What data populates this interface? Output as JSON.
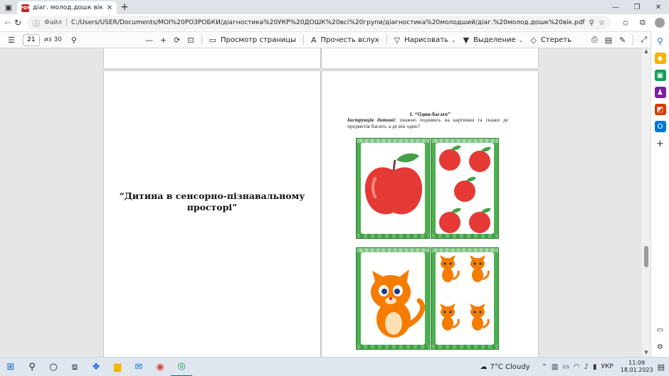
{
  "browser": {
    "tab_title": "діаг. молод.дошк вік.pdf",
    "tab_icon": "PDF",
    "url_label": "Файл",
    "url": "C:/Users/USER/Documents/МОЇ%20РОЗРОБКИ/діагностика%20УКР%20ДОШК%20всі%20групи/діагностика%20молодший/діаг.%20молод.дошк%20вік.pdf"
  },
  "pdf_toolbar": {
    "page_current": "21",
    "page_total_label": "из 30",
    "view_label": "Просмотр страницы",
    "read_aloud_label": "Прочесть вслух",
    "draw_label": "Нарисовать",
    "highlight_label": "Выделение",
    "erase_label": "Стереть"
  },
  "document": {
    "left_page_title": "“Дитина в сенсорно-пізнавальному просторі”",
    "task_heading": "1.  “Один-багато”",
    "task_instruction_label": "Інструкція дитині:",
    "task_instruction_text": " уважно подивись на картинки та скажи де предметів багато, а де він один?"
  },
  "taskbar": {
    "weather": "7°C  Cloudy",
    "language": "УКР",
    "time": "11:09",
    "date": "18.01.2023"
  },
  "colors": {
    "accent": "#0067c0",
    "card_green": "#4caf50",
    "apple_red": "#e53935",
    "cat_orange": "#f57c00"
  }
}
